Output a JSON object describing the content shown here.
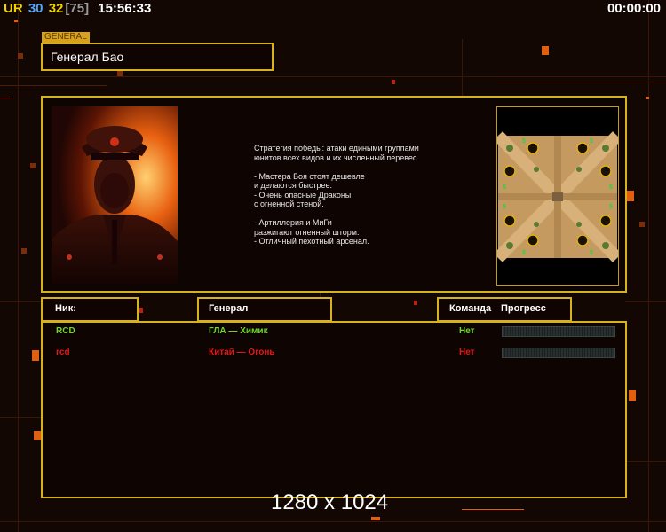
{
  "hud": {
    "badge": "UR",
    "stat1": "30",
    "stat2": "32",
    "stat3": "[75]",
    "clock": "15:56:33",
    "timer": "00:00:00"
  },
  "general": {
    "tag": "GENERAL",
    "name": "Генерал Бао",
    "description": "Стратегия победы: атаки едиными группами\nюнитов всех видов и их численный перевес.\n\n- Мастера Боя стоят дешевле\nи делаются быстрее.\n- Очень опасные Драконы\nс огненной стеной.\n\n- Артиллерия и МиГи\nразжигают огненный шторм.\n- Отличный пехотный арсенал."
  },
  "table": {
    "col_nick": "Ник:",
    "col_general": "Генерал",
    "col_team": "Команда",
    "col_progress": "Прогресс",
    "rows": [
      {
        "nick": "RCD",
        "general": "ГЛА — Химик",
        "team": "Нет",
        "color": "#6fd82a",
        "progress": 0
      },
      {
        "nick": "rcd",
        "general": "Китай — Огонь",
        "team": "Нет",
        "color": "#e01818",
        "progress": 0
      }
    ]
  },
  "footer": {
    "resolution": "1280 x 1024"
  },
  "colors": {
    "accent": "#d6b21c",
    "badge": "#f0d400",
    "stat1": "#4fa8ff",
    "stat2": "#f0d400",
    "stat3": "#9a9a9a"
  }
}
